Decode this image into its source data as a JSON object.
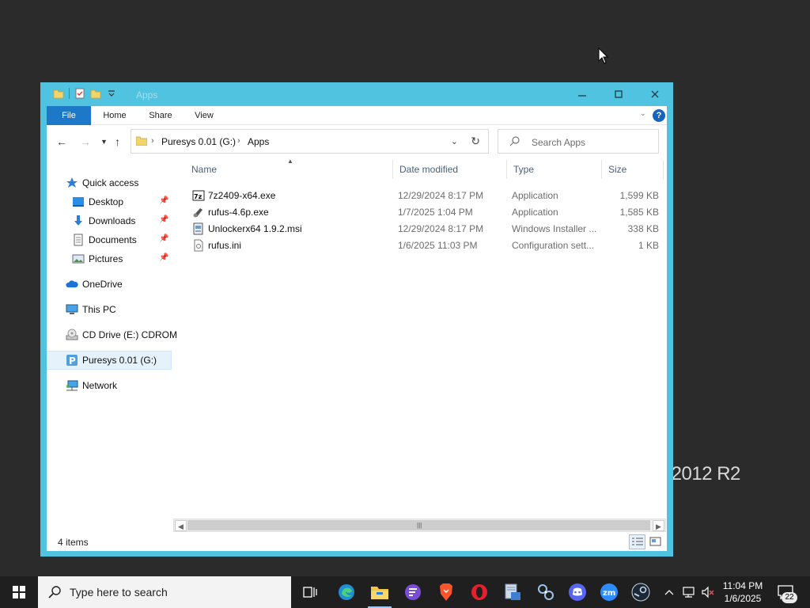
{
  "desktop": {
    "brand_text": "r 2012 R2"
  },
  "window": {
    "title": "Apps",
    "ribbon": {
      "tabs": [
        "File",
        "Home",
        "Share",
        "View"
      ],
      "help_label": "?"
    },
    "address": {
      "crumbs": [
        "Puresys 0.01 (G:)",
        "Apps"
      ]
    },
    "search": {
      "placeholder": "Search Apps"
    },
    "nav": {
      "quick_access": "Quick access",
      "desktop": "Desktop",
      "downloads": "Downloads",
      "documents": "Documents",
      "pictures": "Pictures",
      "onedrive": "OneDrive",
      "this_pc": "This PC",
      "cd_drive": "CD Drive (E:) CDROM",
      "puresys": "Puresys 0.01 (G:)",
      "network": "Network"
    },
    "columns": {
      "name": "Name",
      "date": "Date modified",
      "type": "Type",
      "size": "Size"
    },
    "files": [
      {
        "name": "7z2409-x64.exe",
        "date": "12/29/2024 8:17 PM",
        "type": "Application",
        "size": "1,599 KB",
        "icon": "7zip-icon"
      },
      {
        "name": "rufus-4.6p.exe",
        "date": "1/7/2025 1:04 PM",
        "type": "Application",
        "size": "1,585 KB",
        "icon": "rufus-icon"
      },
      {
        "name": "Unlockerx64 1.9.2.msi",
        "date": "12/29/2024 8:17 PM",
        "type": "Windows Installer ...",
        "size": "338 KB",
        "icon": "msi-icon"
      },
      {
        "name": "rufus.ini",
        "date": "1/6/2025 11:03 PM",
        "type": "Configuration sett...",
        "size": "1 KB",
        "icon": "ini-icon"
      }
    ],
    "status": {
      "item_count": "4 items"
    }
  },
  "taskbar": {
    "search_placeholder": "Type here to search",
    "clock_time": "11:04 PM",
    "clock_date": "1/6/2025",
    "notification_count": "22"
  },
  "colors": {
    "window_border": "#4fc3df",
    "file_tab": "#1e78c8",
    "taskbar": "#1f1f1f"
  }
}
